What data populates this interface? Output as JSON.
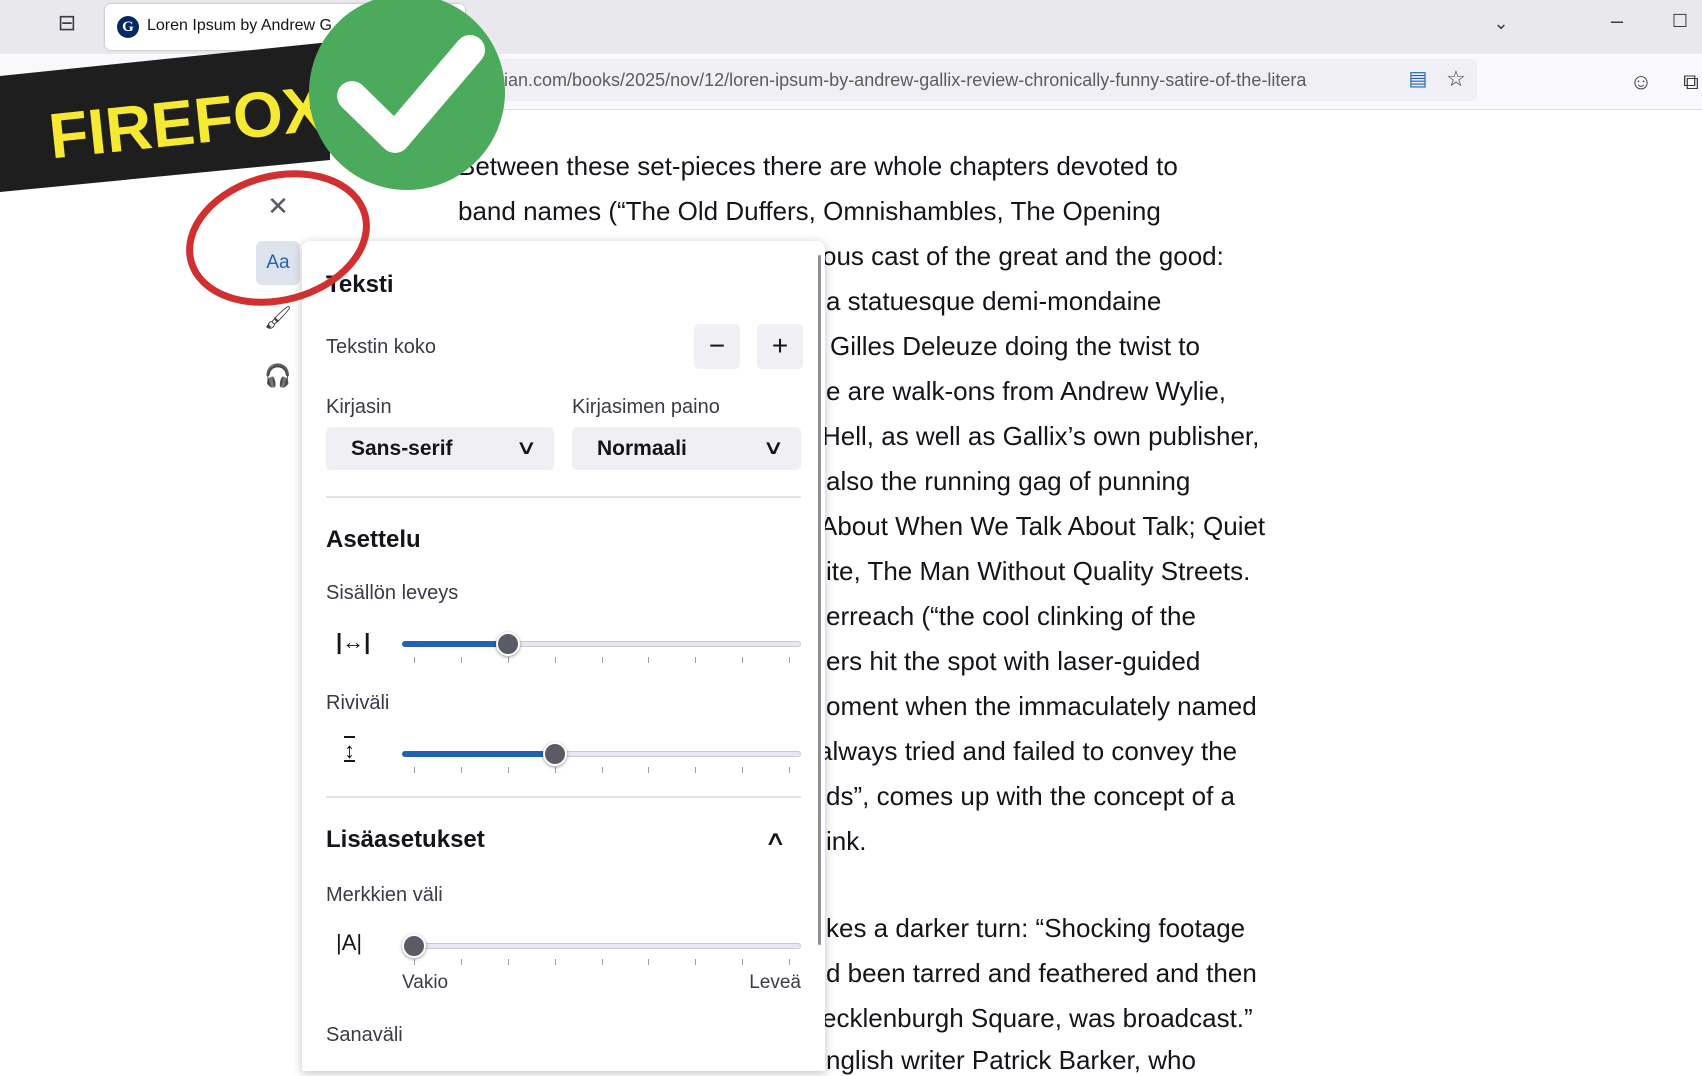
{
  "browser": {
    "tab_title": "Loren Ipsum by Andrew G",
    "url": "ian.com/books/2025/nov/12/loren-ipsum-by-andrew-gallix-review-chronically-funny-satire-of-the-litera"
  },
  "overlay": {
    "banner_text": "FIREFOX",
    "colors": {
      "banner": "#1e1e1e",
      "banner_text": "#f5e933",
      "check": "#4caa5c",
      "circle": "#d03030"
    }
  },
  "sidebar": {
    "aa_label": "Aa"
  },
  "panel": {
    "text_heading": "Teksti",
    "text_size_label": "Tekstin koko",
    "minus": "−",
    "plus": "+",
    "font_label": "Kirjasin",
    "font_value": "Sans-serif",
    "weight_label": "Kirjasimen paino",
    "weight_value": "Normaali",
    "layout_heading": "Asettelu",
    "width_label": "Sisällön leveys",
    "width_step": 2,
    "line_label": "Riviväli",
    "line_step": 3,
    "advanced_heading": "Lisäasetukset",
    "letter_label": "Merkkien väli",
    "letter_step": 0,
    "letter_min": "Vakio",
    "letter_max": "Leveä",
    "word_label": "Sanaväli",
    "slider_steps": 8
  },
  "article": {
    "lines": [
      "Between these set-pieces there are whole chapters devoted to",
      "band names (“The Old Duffers, Omnishambles, The Opening",
      "ous cast of the great and the good:",
      "a statuesque demi-mondaine",
      " Gilles Deleuze doing the twist to",
      "e are walk-ons from Andrew Wylie,",
      "Hell, as well as Gallix’s own publisher,",
      " also the running gag of punning",
      "About When We Talk About Talk; Quiet",
      "ite, The Man Without Quality Streets.",
      "erreach (“the cool clinking of the",
      "ers hit the spot with laser-guided",
      "oment when the immaculately named",
      "always tried and failed to convey the",
      "ds”, comes up with the concept of a",
      "ink.",
      "kes a darker turn: “Shocking footage",
      "d been tarred and feathered and then",
      "ecklenburgh Square, was broadcast.”",
      "nglish writer Patrick Barker, who"
    ]
  }
}
